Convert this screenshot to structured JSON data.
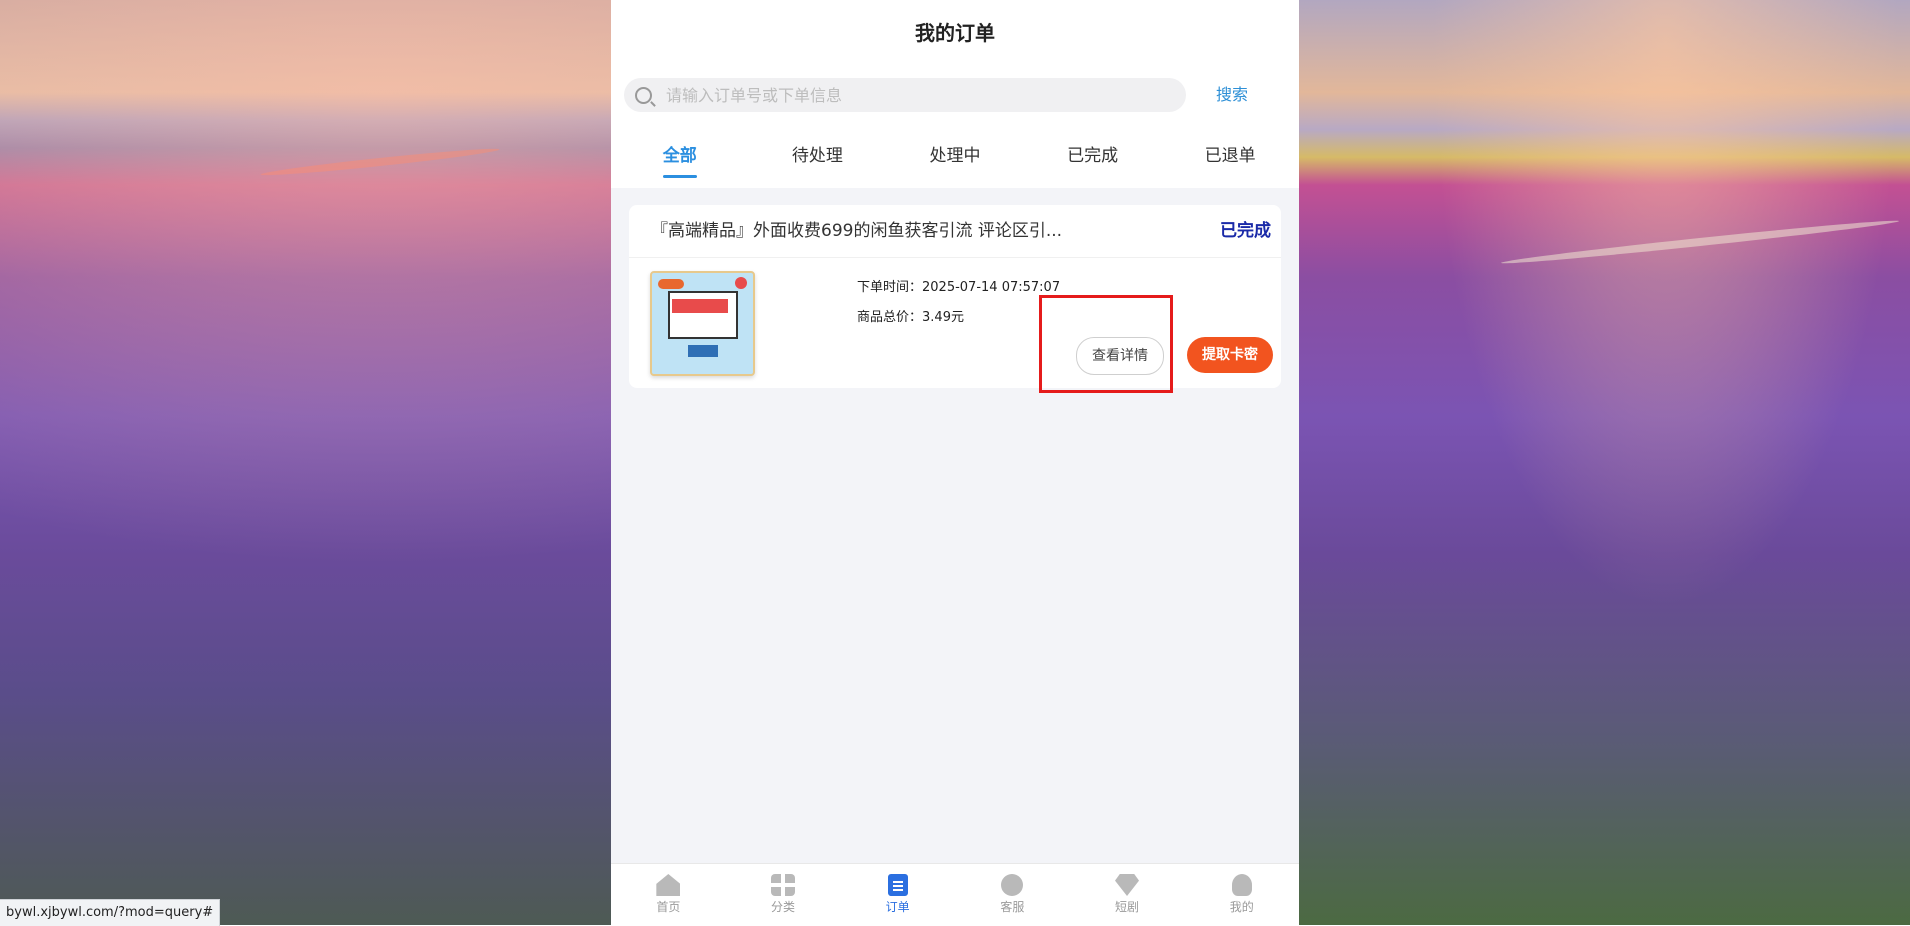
{
  "header": {
    "title": "我的订单"
  },
  "search": {
    "placeholder": "请输入订单号或下单信息",
    "button_label": "搜索"
  },
  "tabs": [
    {
      "label": "全部",
      "active": true
    },
    {
      "label": "待处理",
      "active": false
    },
    {
      "label": "处理中",
      "active": false
    },
    {
      "label": "已完成",
      "active": false
    },
    {
      "label": "已退单",
      "active": false
    }
  ],
  "order": {
    "title": "『高端精品』外面收费699的闲鱼获客引流 评论区引...",
    "status": "已完成",
    "time_label": "下单时间：",
    "time_value": "2025-07-14 07:57:07",
    "price_label": "商品总价：",
    "price_value": "3.49元",
    "detail_button": "查看详情",
    "extract_button": "提取卡密"
  },
  "bottom_nav": [
    {
      "label": "首页",
      "icon": "home-icon"
    },
    {
      "label": "分类",
      "icon": "grid-icon"
    },
    {
      "label": "订单",
      "icon": "order-icon",
      "active": true
    },
    {
      "label": "客服",
      "icon": "headset-icon"
    },
    {
      "label": "短剧",
      "icon": "diamond-icon"
    },
    {
      "label": "我的",
      "icon": "user-icon"
    }
  ],
  "status_bar": {
    "url": "bywl.xjbywl.com/?mod=query#"
  },
  "colors": {
    "accent_blue": "#2b8fe0",
    "status_blue": "#1a2aa8",
    "extract_orange": "#f2541f",
    "highlight_red": "#e51b1b"
  }
}
